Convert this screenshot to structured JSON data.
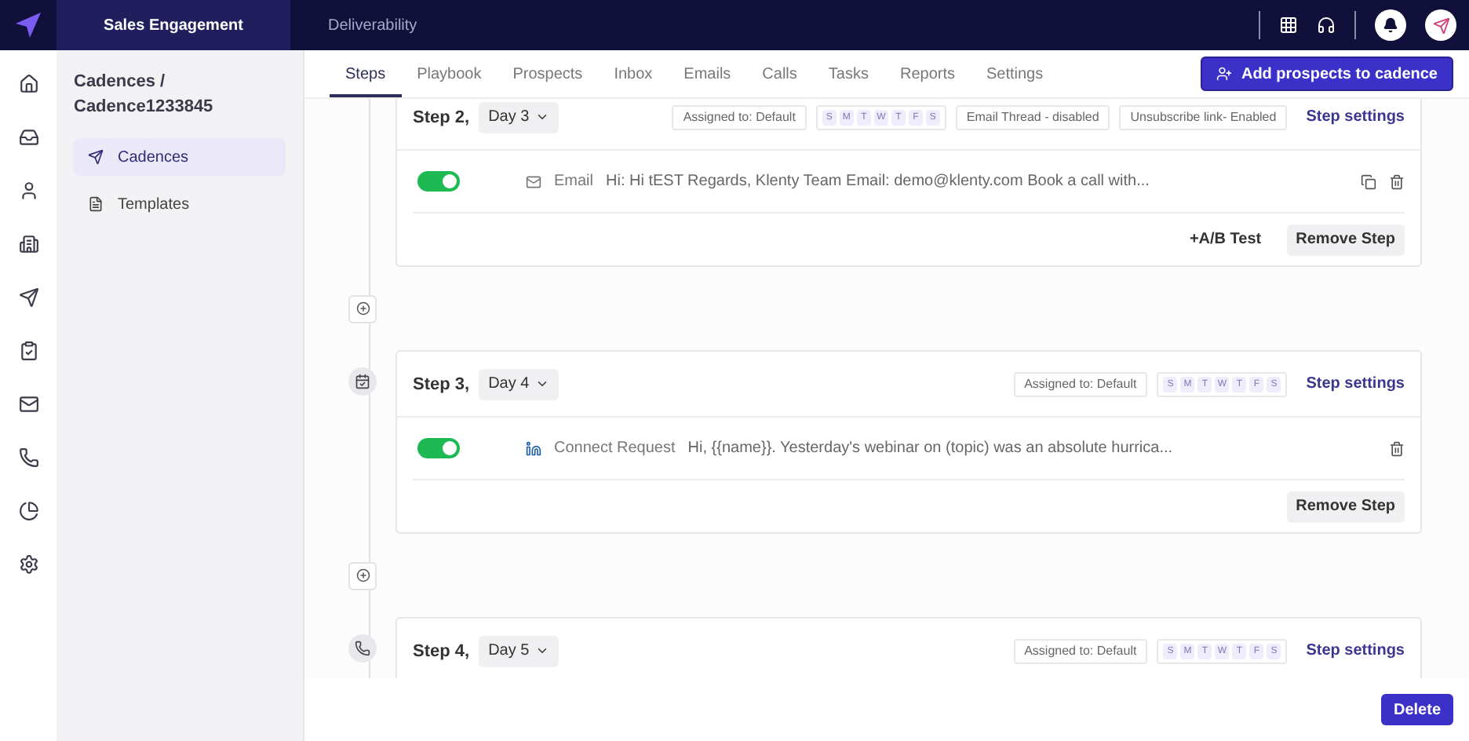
{
  "topbar": {
    "tabs": [
      {
        "label": "Sales Engagement",
        "selected": true
      },
      {
        "label": "Deliverability",
        "selected": false
      }
    ]
  },
  "sidebar": {
    "breadcrumb": "Cadences /",
    "title": "Cadence1233845",
    "items": [
      {
        "label": "Cadences",
        "selected": true
      },
      {
        "label": "Templates",
        "selected": false
      }
    ]
  },
  "tabs": [
    {
      "label": "Steps",
      "selected": true
    },
    {
      "label": "Playbook",
      "selected": false
    },
    {
      "label": "Prospects",
      "selected": false
    },
    {
      "label": "Inbox",
      "selected": false
    },
    {
      "label": "Emails",
      "selected": false
    },
    {
      "label": "Calls",
      "selected": false
    },
    {
      "label": "Tasks",
      "selected": false
    },
    {
      "label": "Reports",
      "selected": false
    },
    {
      "label": "Settings",
      "selected": false
    }
  ],
  "add_prospects_button": "Add prospects to cadence",
  "steps": [
    {
      "title": "Step 2,",
      "day": "Day 3",
      "assigned": "Assigned to: Default",
      "days": [
        "S",
        "M",
        "T",
        "W",
        "T",
        "F",
        "S"
      ],
      "chips": [
        "Email Thread - disabled",
        "Unsubscribe link- Enabled"
      ],
      "settings": "Step settings",
      "items": [
        {
          "kind": "email",
          "on": true,
          "label": "Email",
          "message": "Hi: Hi tEST Regards,  Klenty Team Email: demo@klenty.com Book a call with...",
          "copy": true
        }
      ],
      "ab_test": "+A/B Test",
      "remove": "Remove Step"
    },
    {
      "kind": "task",
      "title": "Step 3,",
      "day": "Day 4",
      "assigned": "Assigned to: Default",
      "days": [
        "S",
        "M",
        "T",
        "W",
        "T",
        "F",
        "S"
      ],
      "settings": "Step settings",
      "items": [
        {
          "kind": "linkedin",
          "on": true,
          "label": "Connect Request",
          "message": "Hi, {{name}}. Yesterday's webinar on (topic) was an absolute hurrica...",
          "copy": false
        }
      ],
      "remove": "Remove Step"
    },
    {
      "kind": "call",
      "title": "Step 4,",
      "day": "Day 5",
      "assigned": "Assigned to: Default",
      "days": [
        "S",
        "M",
        "T",
        "W",
        "T",
        "F",
        "S"
      ],
      "settings": "Step settings"
    }
  ],
  "delete_button": "Delete"
}
